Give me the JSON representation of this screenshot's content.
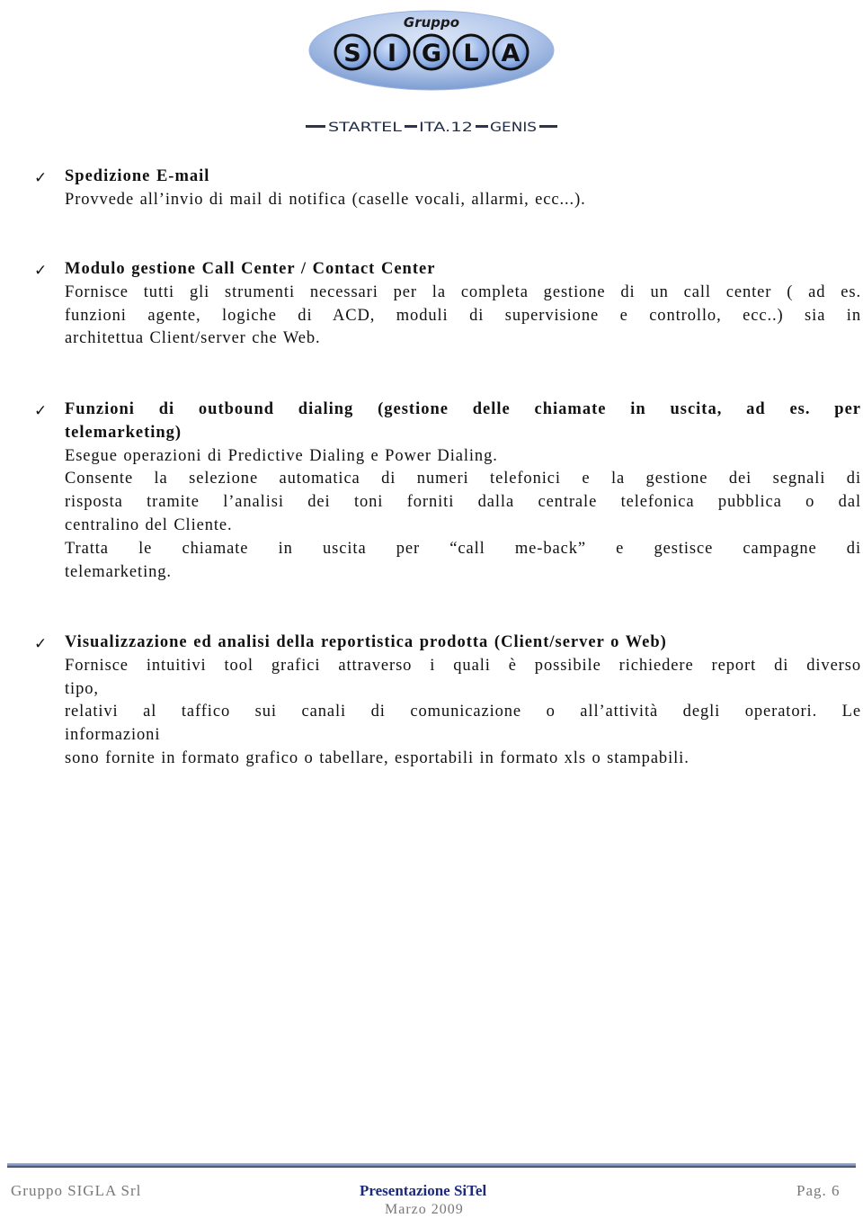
{
  "logo": {
    "top_text": "Gruppo",
    "letters": [
      "S",
      "I",
      "G",
      "L",
      "A"
    ],
    "tagline_parts": [
      "STARTEL",
      "ITA.12",
      "GENIS"
    ],
    "colors": {
      "ellipse": "#b7c9ea",
      "ellipse_dark": "#6f8fc8",
      "letter_disc": "#8fb0e6",
      "letter_ring": "#1a1a1a",
      "tagline": "#1f2a44"
    }
  },
  "sections": [
    {
      "icon": "checkmark-icon",
      "title_lines": [
        "Spedizione E-mail"
      ],
      "body_lines": [
        "Provvede all’invio di mail di notifica (caselle vocali, allarmi, ecc...)."
      ]
    },
    {
      "icon": "checkmark-icon",
      "title_lines": [
        "Modulo gestione Call Center / Contact Center"
      ],
      "body_lines": [
        "Fornisce tutti gli strumenti necessari per la completa gestione di un call center ( ad es.",
        "funzioni agente, logiche di ACD, moduli di supervisione e controllo, ecc..) sia in",
        "architettua Client/server che Web."
      ]
    },
    {
      "icon": "checkmark-icon",
      "title_lines": [
        "Funzioni di outbound dialing (gestione delle chiamate in uscita, ad es. per",
        "telemarketing)"
      ],
      "body_lines": [
        "Esegue operazioni di Predictive Dialing e Power Dialing.",
        "Consente la selezione automatica di numeri telefonici e la gestione dei segnali di",
        "risposta tramite l’analisi dei toni forniti dalla centrale telefonica pubblica o dal",
        "centralino del Cliente.",
        "Tratta le chiamate in uscita per “call me-back” e gestisce campagne di",
        "telemarketing."
      ]
    },
    {
      "icon": "checkmark-icon",
      "title_lines": [
        "Visualizzazione ed analisi della reportistica prodotta (Client/server o Web)"
      ],
      "body_lines": [
        "Fornisce intuitivi tool grafici attraverso i quali è possibile richiedere report di diverso",
        "tipo,",
        "relativi al taffico sui canali di comunicazione o all’attività degli operatori. Le",
        "informazioni",
        "sono fornite in formato grafico o tabellare, esportabili in formato xls o stampabili."
      ]
    }
  ],
  "footer": {
    "company": "Gruppo SIGLA Srl",
    "presentation": "Presentazione SiTel",
    "date": "Marzo 2009",
    "page": "Pag. 6"
  }
}
